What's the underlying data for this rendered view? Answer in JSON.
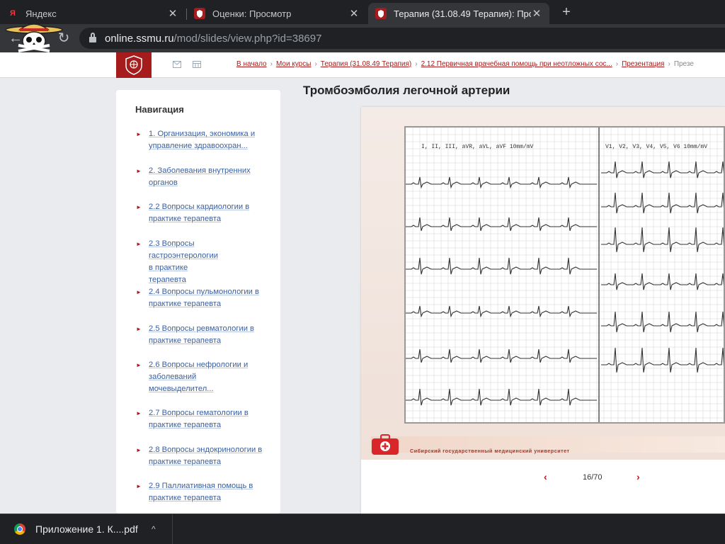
{
  "browser": {
    "tabs": [
      {
        "title": "Яндекс",
        "favicon": "yandex-icon",
        "active": false
      },
      {
        "title": "Оценки: Просмотр",
        "favicon": "ssmu-icon",
        "active": false
      },
      {
        "title": "Терапия (31.08.49 Терапия): Про",
        "favicon": "ssmu-icon",
        "active": true
      }
    ],
    "new_tab_symbol": "+",
    "close_symbol": "✕",
    "url_host": "online.ssmu.ru",
    "url_path": "/mod/slides/view.php?id=38697"
  },
  "header": {
    "breadcrumbs": [
      "В начало",
      "Мои курсы",
      "Терапия (31.08.49 Терапия)",
      "2.12 Первичная врачебная помощь при неотложных сос...",
      "Презентация"
    ],
    "breadcrumb_current": "Презе",
    "separator": "›"
  },
  "navigation": {
    "title": "Навигация",
    "items": [
      {
        "label": "1. Организация, экономика и управление здравоохран..."
      },
      {
        "label": "2. Заболевания внутренних органов"
      },
      {
        "label": "2.2 Вопросы кардиологии в практике терапевта"
      },
      {
        "label": "2.3 Вопросы гастроэнтерологии в практике терапевта"
      },
      {
        "label": "2.4 Вопросы пульмонологии в практике терапевта"
      },
      {
        "label": "2.5 Вопросы ревматологии в практике терапевта"
      },
      {
        "label": "2.6 Вопросы нефрологии и заболеваний мочевыделител..."
      },
      {
        "label": "2.7 Вопросы гематологии в практике терапевта"
      },
      {
        "label": "2.8 Вопросы эндокринологии в практике терапевта"
      },
      {
        "label": "2.9 Паллиативная помощь в практике терапевта"
      }
    ]
  },
  "slide": {
    "title": "Тромбоэмболия легочной артерии",
    "ecg_labels_left": "I, II, III, aVR, aVL, aVF   10mm/mV",
    "ecg_labels_right": "V1, V2, V3, V4, V5, V6   10mm/mV",
    "footer_text": "Сибирский государственный медицинский университет",
    "page_counter": "16/70",
    "prev_symbol": "‹",
    "next_symbol": "›"
  },
  "downloads": {
    "filename": "Приложение 1. К....pdf",
    "caret": "^"
  },
  "colors": {
    "brand_red": "#a61b1b",
    "link_blue": "#3a5fa0",
    "chrome_dark": "#202124"
  }
}
